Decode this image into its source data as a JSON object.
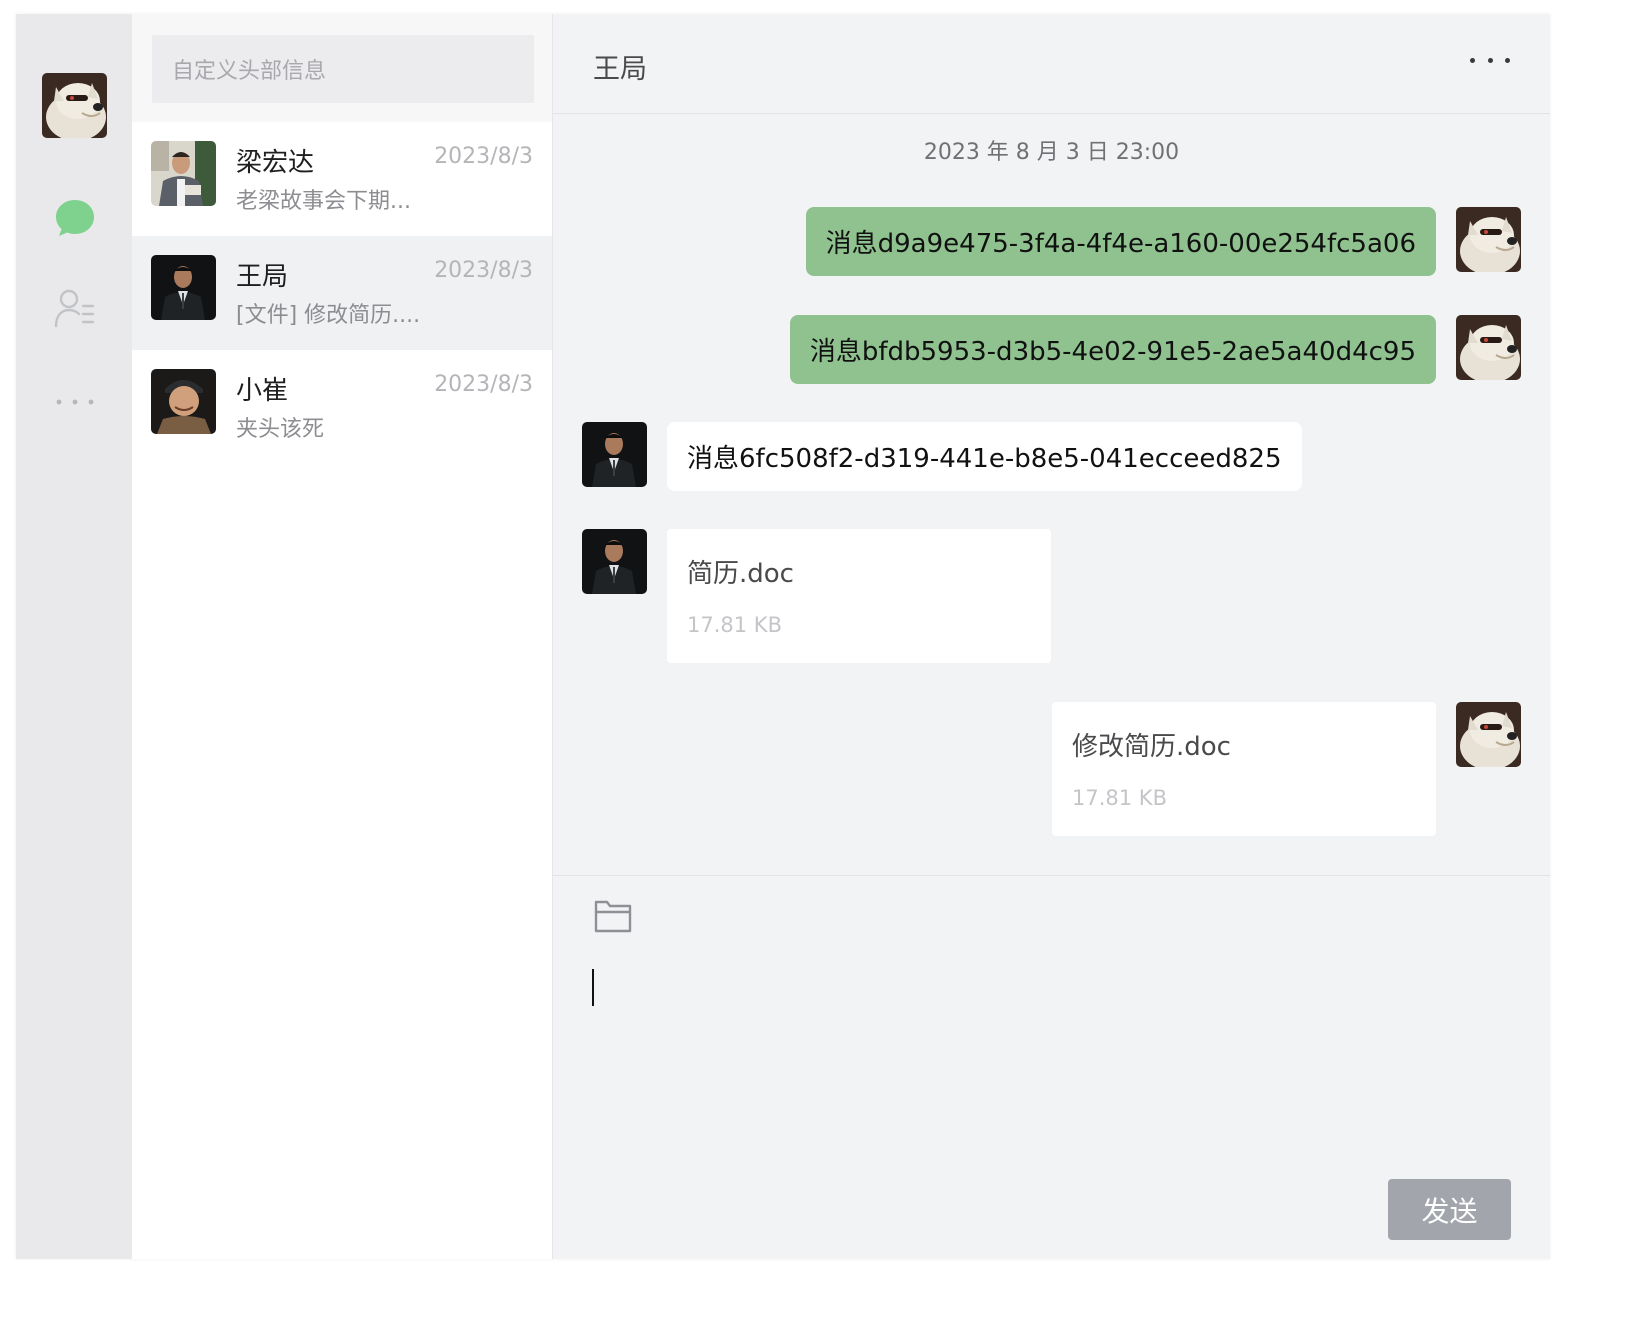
{
  "colors": {
    "nav_bg": "#e9e9eb",
    "chat_bg": "#f2f3f5",
    "accent_green": "#8fc28f",
    "nav_chat_icon": "#7ed28e",
    "send_button": "#a2a5ab"
  },
  "sidebar": {
    "items": [
      {
        "name": "chat-icon"
      },
      {
        "name": "contacts-icon"
      },
      {
        "name": "more-icon"
      }
    ]
  },
  "list": {
    "search_placeholder": "自定义头部信息",
    "conversations": [
      {
        "name": "梁宏达",
        "time": "2023/8/3",
        "preview": "老梁故事会下期..."
      },
      {
        "name": "王局",
        "time": "2023/8/3",
        "preview": "[文件] 修改简历...."
      },
      {
        "name": "小崔",
        "time": "2023/8/3",
        "preview": "夹头该死"
      }
    ]
  },
  "chat": {
    "title": "王局",
    "timestamp": "2023 年 8 月 3 日 23:00",
    "messages": [
      {
        "type": "text",
        "from": "me",
        "text": "消息d9a9e475-3f4a-4f4e-a160-00e254fc5a06"
      },
      {
        "type": "text",
        "from": "me",
        "text": "消息bfdb5953-d3b5-4e02-91e5-2ae5a40d4c95"
      },
      {
        "type": "text",
        "from": "other",
        "text": "消息6fc508f2-d319-441e-b8e5-041ecceed825"
      },
      {
        "type": "file",
        "from": "other",
        "filename": "简历.doc",
        "size": "17.81 KB"
      },
      {
        "type": "file",
        "from": "me",
        "filename": "修改简历.doc",
        "size": "17.81 KB"
      }
    ]
  },
  "composer": {
    "value": "",
    "send_label": "发送"
  }
}
